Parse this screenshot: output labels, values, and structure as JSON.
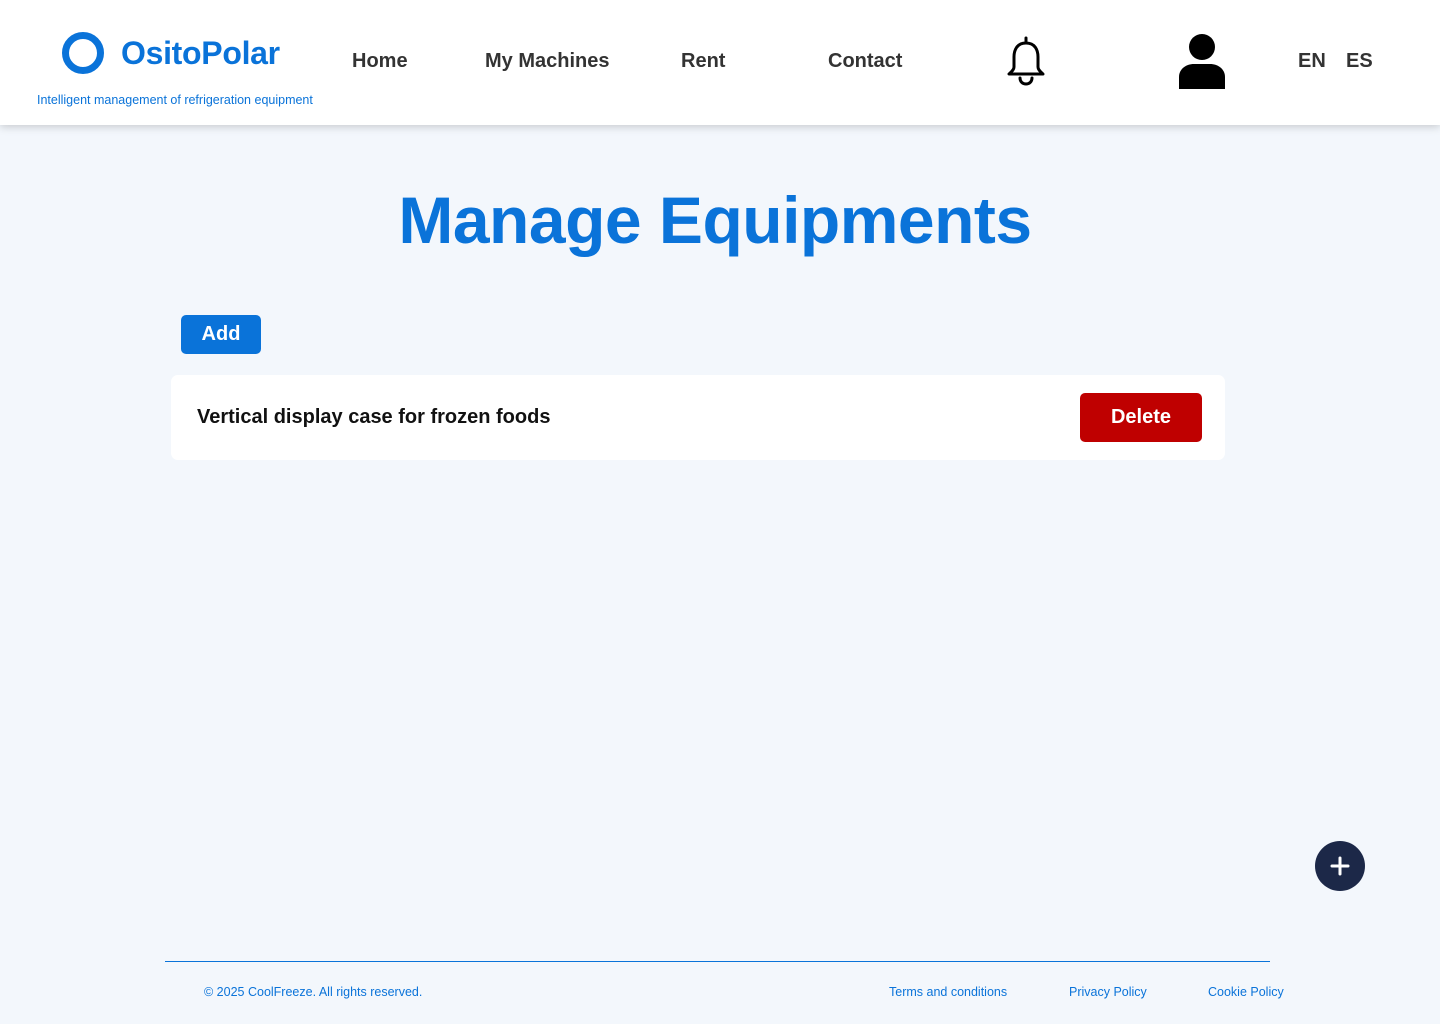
{
  "brand": {
    "name": "OsitoPolar",
    "tagline": "Intelligent management of refrigeration equipment",
    "color": "#0a73d9"
  },
  "nav": {
    "home": "Home",
    "machines": "My Machines",
    "rent": "Rent",
    "contact": "Contact"
  },
  "header_icons": {
    "notifications": "bell-icon",
    "profile": "user-icon"
  },
  "languages": [
    "EN",
    "ES"
  ],
  "main": {
    "title": "Manage Equipments",
    "add_label": "Add",
    "equipments": [
      {
        "name": "Vertical display case for frozen foods",
        "delete_label": "Delete"
      }
    ]
  },
  "fab": {
    "icon": "plus-icon"
  },
  "footer": {
    "copyright": "© 2025 CoolFreeze. All rights reserved.",
    "terms": "Terms and conditions",
    "privacy": "Privacy Policy",
    "cookie": "Cookie Policy"
  },
  "colors": {
    "accent": "#0a73d9",
    "danger": "#bf0000",
    "fab": "#1c2848",
    "background": "#f3f7fc"
  }
}
